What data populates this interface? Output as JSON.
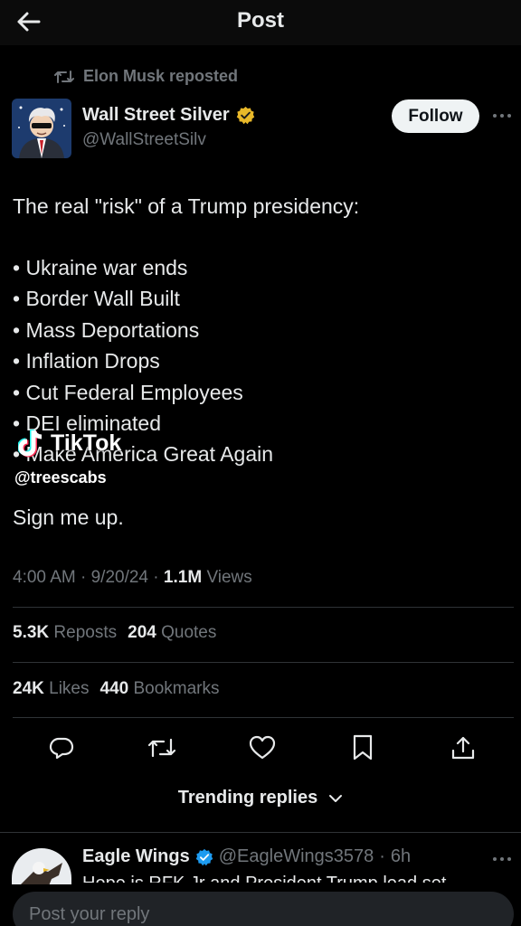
{
  "header": {
    "title": "Post"
  },
  "repost": {
    "text": "Elon Musk reposted"
  },
  "author": {
    "name": "Wall Street Silver",
    "handle": "@WallStreetSilv",
    "follow_label": "Follow"
  },
  "tweet": {
    "intro": "The real \"risk\" of a Trump presidency:",
    "items": [
      "• Ukraine war ends",
      "• Border Wall Built",
      "• Mass Deportations",
      "• Inflation Drops",
      "• Cut Federal Employees",
      "• DEI eliminated",
      "• Make America Great Again"
    ],
    "outro": "Sign me up."
  },
  "meta": {
    "time": "4:00 AM",
    "date": "9/20/24",
    "views_count": "1.1M",
    "views_label": "Views"
  },
  "stats": {
    "reposts": {
      "count": "5.3K",
      "label": "Reposts"
    },
    "quotes": {
      "count": "204",
      "label": "Quotes"
    },
    "likes": {
      "count": "24K",
      "label": "Likes"
    },
    "bookmarks": {
      "count": "440",
      "label": "Bookmarks"
    }
  },
  "actions": [
    "reply-icon",
    "repost-icon",
    "like-icon",
    "bookmark-icon",
    "share-icon"
  ],
  "trending": {
    "label": "Trending replies"
  },
  "reply": {
    "name": "Eagle Wings",
    "handle": "@EagleWings3578",
    "time": "6h",
    "preview": "Hope is RFK Jr and President Trump lead set"
  },
  "compose": {
    "placeholder": "Post your reply"
  },
  "watermark": {
    "brand": "TikTok",
    "user": "@treescabs"
  },
  "colors": {
    "background": "#000000",
    "text": "#e7e9ea",
    "muted": "#71767b",
    "verified_gold": "#e8b829",
    "verified_blue": "#1d9bf0",
    "divider": "#2f3336"
  }
}
